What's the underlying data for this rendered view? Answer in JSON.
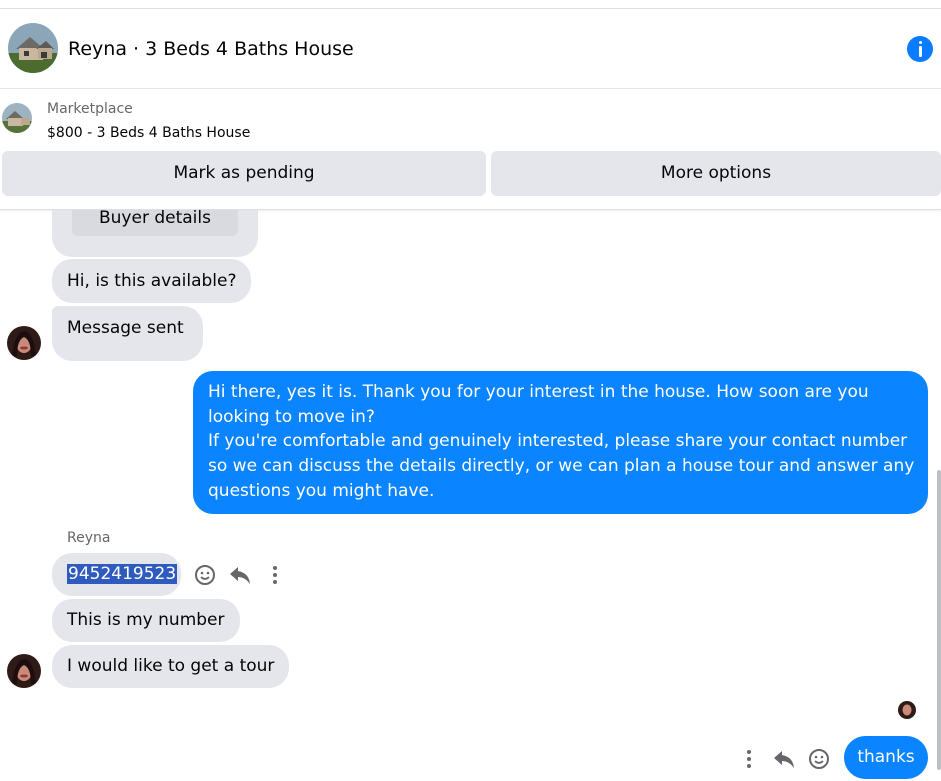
{
  "header": {
    "title": "Reyna · 3 Beds 4 Baths House",
    "info_icon": "info-icon"
  },
  "listing": {
    "label": "Marketplace",
    "title": "$800 - 3 Beds 4 Baths House",
    "mark_pending": "Mark as pending",
    "more_options": "More options"
  },
  "messages": {
    "buyer_details": "Buyer details",
    "m1": "Hi, is this available?",
    "m2": "Message sent",
    "sent_lines": [
      "Hi there, yes it is. Thank you for your interest in the house. How soon are you",
      "looking to move in?",
      "If you're comfortable and genuinely interested, please share your contact number",
      "so we can discuss the details directly, or we can plan a house tour and answer any",
      "questions you might have."
    ],
    "sender_name": "Reyna",
    "phone": "9452419523",
    "m3": "This is my number",
    "m4": "I would like to get a tour",
    "thanks": "thanks"
  },
  "colors": {
    "accent": "#0a84ff",
    "bubble_gray": "#e4e6eb",
    "selection": "#2f5bbf"
  }
}
